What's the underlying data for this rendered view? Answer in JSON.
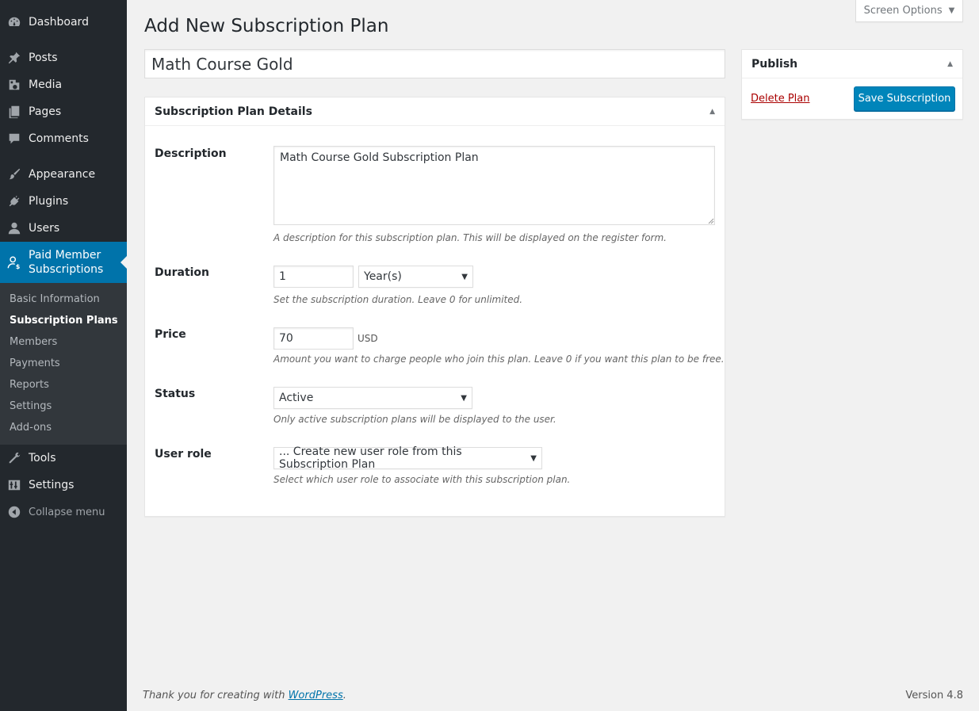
{
  "sidebar": {
    "menu": [
      {
        "label": "Dashboard",
        "icon": "dashboard-icon"
      },
      {
        "label": "Posts",
        "icon": "pin-icon"
      },
      {
        "label": "Media",
        "icon": "media-icon"
      },
      {
        "label": "Pages",
        "icon": "pages-icon"
      },
      {
        "label": "Comments",
        "icon": "comments-icon"
      },
      {
        "label": "Appearance",
        "icon": "paintbrush-icon"
      },
      {
        "label": "Plugins",
        "icon": "plugins-icon"
      },
      {
        "label": "Users",
        "icon": "users-icon"
      },
      {
        "label": "Paid Member Subscriptions",
        "label_line1": "Paid Member",
        "label_line2": "Subscriptions",
        "icon": "member-dollar-icon"
      },
      {
        "label": "Tools",
        "icon": "tools-icon"
      },
      {
        "label": "Settings",
        "icon": "settings-icon"
      },
      {
        "label": "Collapse menu",
        "icon": "collapse-icon"
      }
    ],
    "submenu": [
      {
        "label": "Basic Information"
      },
      {
        "label": "Subscription Plans"
      },
      {
        "label": "Members"
      },
      {
        "label": "Payments"
      },
      {
        "label": "Reports"
      },
      {
        "label": "Settings"
      },
      {
        "label": "Add-ons"
      }
    ]
  },
  "screen_options": {
    "label": "Screen Options"
  },
  "page": {
    "title": "Add New Subscription Plan",
    "plan_title_value": "Math Course Gold"
  },
  "details": {
    "heading": "Subscription Plan Details",
    "description": {
      "label": "Description",
      "value": "Math Course Gold Subscription Plan",
      "help": "A description for this subscription plan. This will be displayed on the register form."
    },
    "duration": {
      "label": "Duration",
      "value": "1",
      "unit": "Year(s)",
      "help": "Set the subscription duration. Leave 0 for unlimited."
    },
    "price": {
      "label": "Price",
      "value": "70",
      "currency": "USD",
      "help": "Amount you want to charge people who join this plan. Leave 0 if you want this plan to be free."
    },
    "status": {
      "label": "Status",
      "value": "Active",
      "help": "Only active subscription plans will be displayed to the user."
    },
    "user_role": {
      "label": "User role",
      "value": "... Create new user role from this Subscription Plan",
      "help": "Select which user role to associate with this subscription plan."
    }
  },
  "publish": {
    "heading": "Publish",
    "delete_label": "Delete Plan",
    "save_label": "Save Subscription"
  },
  "footer": {
    "thanks_prefix": "Thank you for creating with ",
    "link_text": "WordPress",
    "thanks_suffix": ".",
    "version": "Version 4.8"
  },
  "colors": {
    "sidebar_bg": "#23282d",
    "submenu_bg": "#32373c",
    "accent": "#0073aa",
    "button": "#0085ba",
    "delete": "#aa0000"
  }
}
